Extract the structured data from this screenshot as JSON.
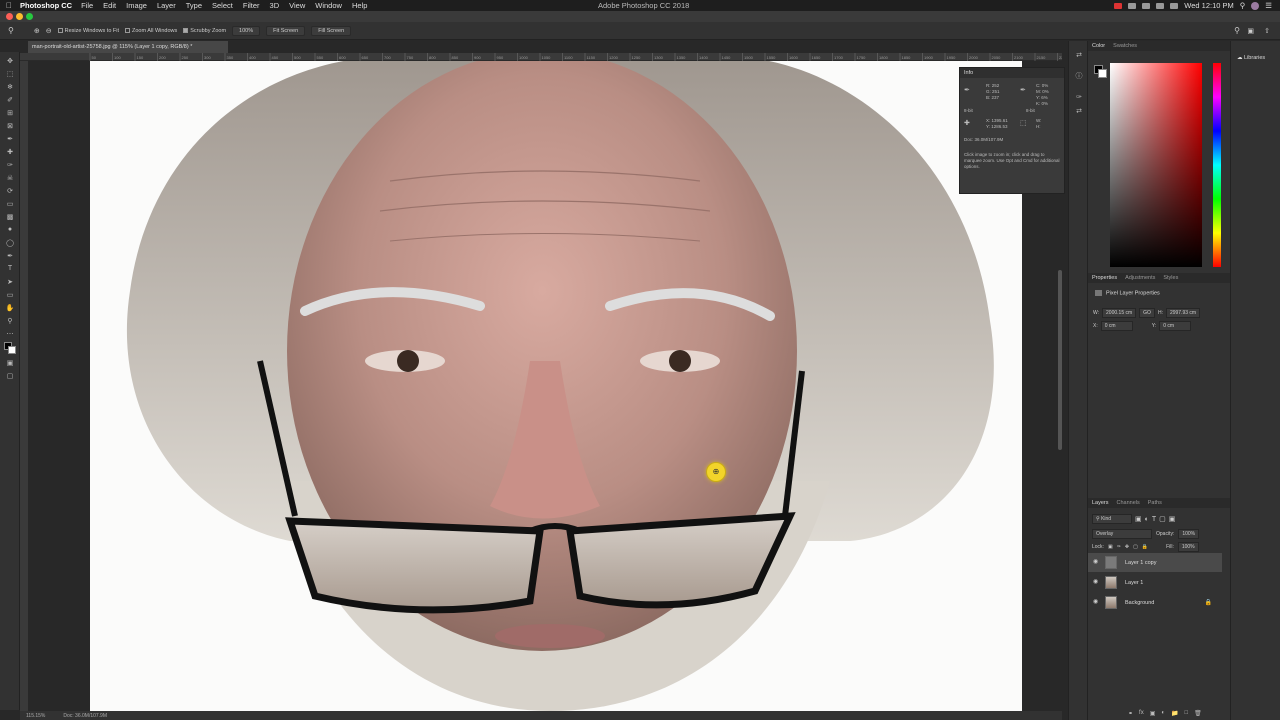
{
  "menubar": {
    "app_name": "Photoshop CC",
    "items": [
      "File",
      "Edit",
      "Image",
      "Layer",
      "Type",
      "Select",
      "Filter",
      "3D",
      "View",
      "Window",
      "Help"
    ],
    "window_title": "Adobe Photoshop CC 2018",
    "clock": "Wed 12:10 PM"
  },
  "options_bar": {
    "resize_windows": "Resize Windows to Fit",
    "zoom_all": "Zoom All Windows",
    "scrubby_zoom": "Scrubby Zoom",
    "zoom_value": "100%",
    "fit_screen": "Fit Screen",
    "fill_screen": "Fill Screen"
  },
  "document": {
    "tab_title": "man-portrait-old-artist-25758.jpg @ 115% (Layer 1 copy, RGB/8) *",
    "zoom": "115.15%",
    "doc_size": "Doc: 36.0M/107.9M"
  },
  "ruler_ticks": [
    "50",
    "100",
    "150",
    "200",
    "250",
    "300",
    "350",
    "400",
    "450",
    "500",
    "550",
    "600",
    "650",
    "700",
    "750",
    "800",
    "850",
    "900",
    "950",
    "1000",
    "1050",
    "1100",
    "1150",
    "1200",
    "1250",
    "1300",
    "1350",
    "1400",
    "1450",
    "1500",
    "1550",
    "1600",
    "1650",
    "1700",
    "1750",
    "1800",
    "1850",
    "1900",
    "1950",
    "2000",
    "2050",
    "2100",
    "2150",
    "2200"
  ],
  "info_panel": {
    "title": "Info",
    "r_label": "R:",
    "r_val": "252",
    "g_label": "G:",
    "g_val": "251",
    "b_label": "B:",
    "b_val": "237",
    "c_label": "C:",
    "c_val": "0%",
    "m_label": "M:",
    "m_val": "0%",
    "y_label": "Y:",
    "y_val": "6%",
    "k_label": "K:",
    "k_val": "0%",
    "bit_left": "8-bit",
    "bit_right": "8-bit",
    "x_label": "X:",
    "x_val": "1395.61",
    "yc_label": "Y:",
    "yc_val": "1286.53",
    "w_label": "W:",
    "h_label": "H:",
    "doc": "Doc: 36.0M/107.9M",
    "hint": "Click image to zoom in; click and drag to marquee zoom. Use Opt and Cmd for additional options."
  },
  "color_panel": {
    "tab_color": "Color",
    "tab_swatches": "Swatches",
    "hue_color": "#ff0000"
  },
  "properties_panel": {
    "tab_properties": "Properties",
    "tab_adjustments": "Adjustments",
    "tab_styles": "Styles",
    "heading": "Pixel Layer Properties",
    "w_label": "W:",
    "w_val": "2000.15 cm",
    "link_label": "GO",
    "h_label": "H:",
    "h_val": "2997.93 cm",
    "x_label": "X:",
    "x_val": "0 cm",
    "y_label": "Y:",
    "y_val": "0 cm"
  },
  "layers_panel": {
    "tab_layers": "Layers",
    "tab_channels": "Channels",
    "tab_paths": "Paths",
    "filter_kind": "Kind",
    "blend_mode": "Overlay",
    "opacity_label": "Opacity:",
    "opacity_val": "100%",
    "lock_label": "Lock:",
    "fill_label": "Fill:",
    "fill_val": "100%",
    "layers": [
      "Layer 1 copy",
      "Layer 1",
      "Background"
    ]
  },
  "libraries_panel": {
    "label": "Libraries"
  }
}
